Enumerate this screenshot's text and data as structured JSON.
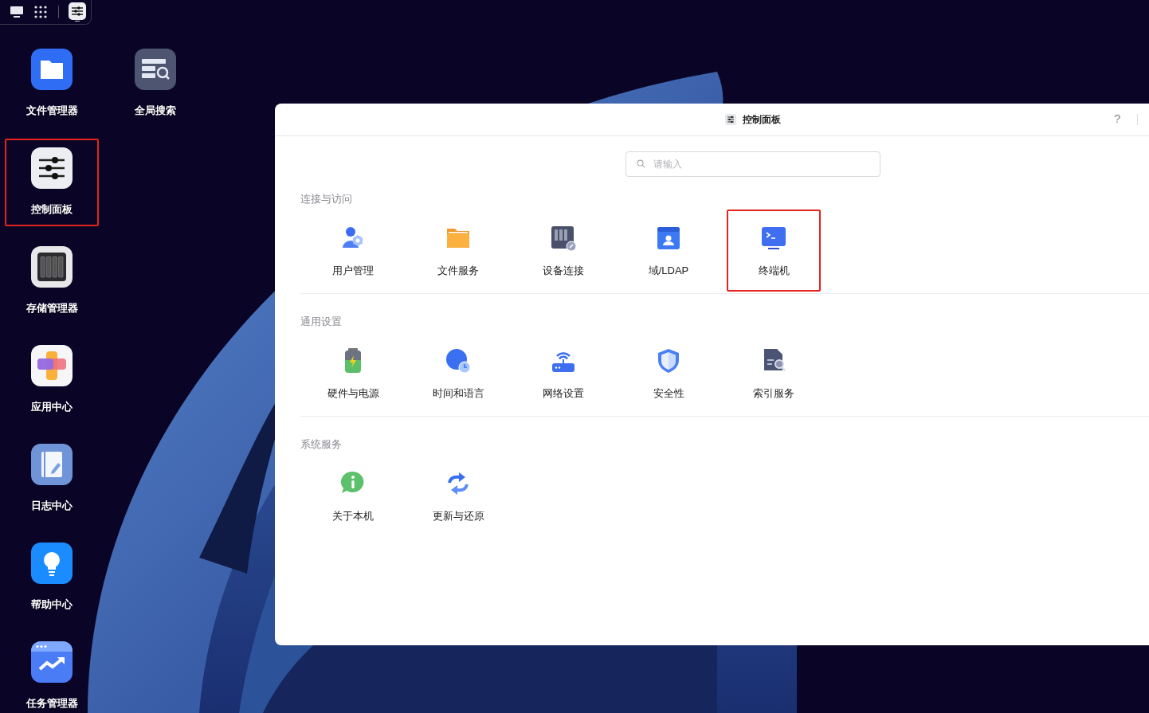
{
  "desktop": {
    "columns": [
      {
        "icons": [
          {
            "label": "文件管理器",
            "highlighted": false
          },
          {
            "label": "控制面板",
            "highlighted": true
          },
          {
            "label": "存储管理器",
            "highlighted": false
          },
          {
            "label": "应用中心",
            "highlighted": false
          },
          {
            "label": "日志中心",
            "highlighted": false
          },
          {
            "label": "帮助中心",
            "highlighted": false
          },
          {
            "label": "任务管理器",
            "highlighted": false
          }
        ]
      },
      {
        "icons": [
          {
            "label": "全局搜索",
            "highlighted": false
          }
        ]
      }
    ]
  },
  "window": {
    "title": "控制面板",
    "help": "?",
    "search": {
      "placeholder": "请输入"
    },
    "sections": [
      {
        "title": "连接与访问",
        "items": [
          {
            "label": "用户管理",
            "highlighted": false
          },
          {
            "label": "文件服务",
            "highlighted": false
          },
          {
            "label": "设备连接",
            "highlighted": false
          },
          {
            "label": "域/LDAP",
            "highlighted": false
          },
          {
            "label": "终端机",
            "highlighted": true
          }
        ]
      },
      {
        "title": "通用设置",
        "items": [
          {
            "label": "硬件与电源",
            "highlighted": false
          },
          {
            "label": "时间和语言",
            "highlighted": false
          },
          {
            "label": "网络设置",
            "highlighted": false
          },
          {
            "label": "安全性",
            "highlighted": false
          },
          {
            "label": "索引服务",
            "highlighted": false
          }
        ]
      },
      {
        "title": "系统服务",
        "items": [
          {
            "label": "关于本机",
            "highlighted": false
          },
          {
            "label": "更新与还原",
            "highlighted": false
          }
        ]
      }
    ]
  }
}
